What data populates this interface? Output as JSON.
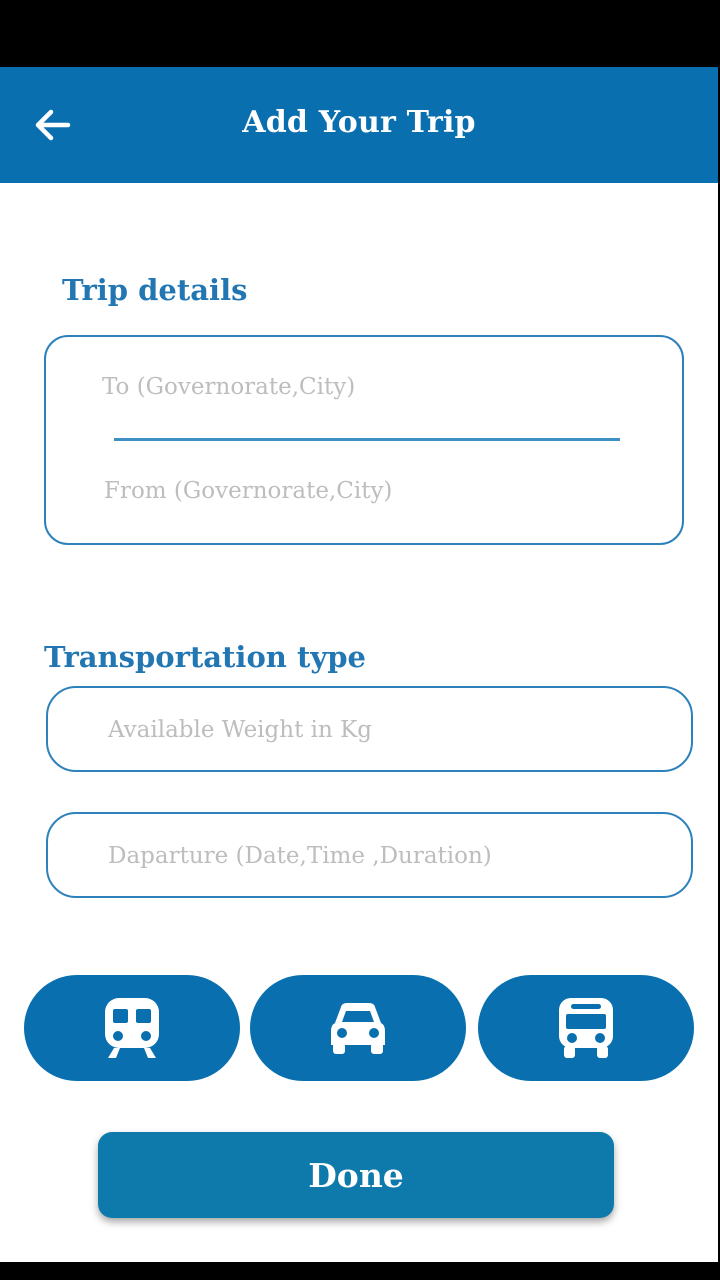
{
  "app_bar": {
    "title": "Add Your Trip",
    "back_icon": "arrow-left-icon",
    "background": "#0a6fae"
  },
  "trip_details": {
    "label": "Trip details",
    "to_placeholder": "To (Governorate,City)",
    "to_value": "",
    "from_placeholder": "From (Governorate,City)",
    "from_value": ""
  },
  "transportation": {
    "label": "Transportation type",
    "weight_placeholder": "Available Weight in Kg",
    "weight_value": "",
    "departure_placeholder": "Daparture (Date,Time ,Duration)",
    "departure_value": "",
    "options": [
      {
        "icon": "train-icon"
      },
      {
        "icon": "car-icon"
      },
      {
        "icon": "bus-icon"
      }
    ]
  },
  "done_button": {
    "label": "Done"
  },
  "colors": {
    "accent": "#0a6fae",
    "label_text": "#2277b3",
    "border": "#2d82bb",
    "placeholder": "#bdbdbd",
    "done_button": "#0e7aab"
  }
}
